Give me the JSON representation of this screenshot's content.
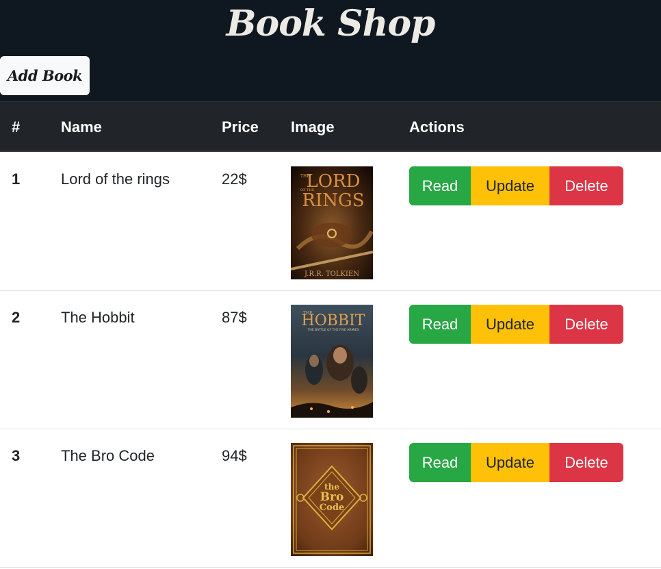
{
  "header": {
    "title": "Book Shop",
    "add_button": "Add Book"
  },
  "table": {
    "columns": [
      "#",
      "Name",
      "Price",
      "Image",
      "Actions"
    ],
    "rows": [
      {
        "num": "1",
        "name": "Lord of the rings",
        "price": "22$",
        "cover": {
          "title_line1": "LORD",
          "title_line2": "RINGS",
          "prefix": "THE",
          "of": "OF THE",
          "author": "J.R.R. TOLKIEN"
        }
      },
      {
        "num": "2",
        "name": "The Hobbit",
        "price": "87$",
        "cover": {
          "title_line1": "HOBBIT",
          "prefix": "THE",
          "subtitle": "THE BATTLE OF THE FIVE ARMIES"
        }
      },
      {
        "num": "3",
        "name": "The Bro Code",
        "price": "94$",
        "cover": {
          "line1": "the",
          "line2": "Bro",
          "line3": "Code"
        }
      }
    ],
    "actions": {
      "read": "Read",
      "update": "Update",
      "delete": "Delete"
    }
  },
  "colors": {
    "header_bg": "#0f1720",
    "table_head_bg": "#212529",
    "read": "#28a745",
    "update": "#ffc107",
    "delete": "#dc3545"
  }
}
